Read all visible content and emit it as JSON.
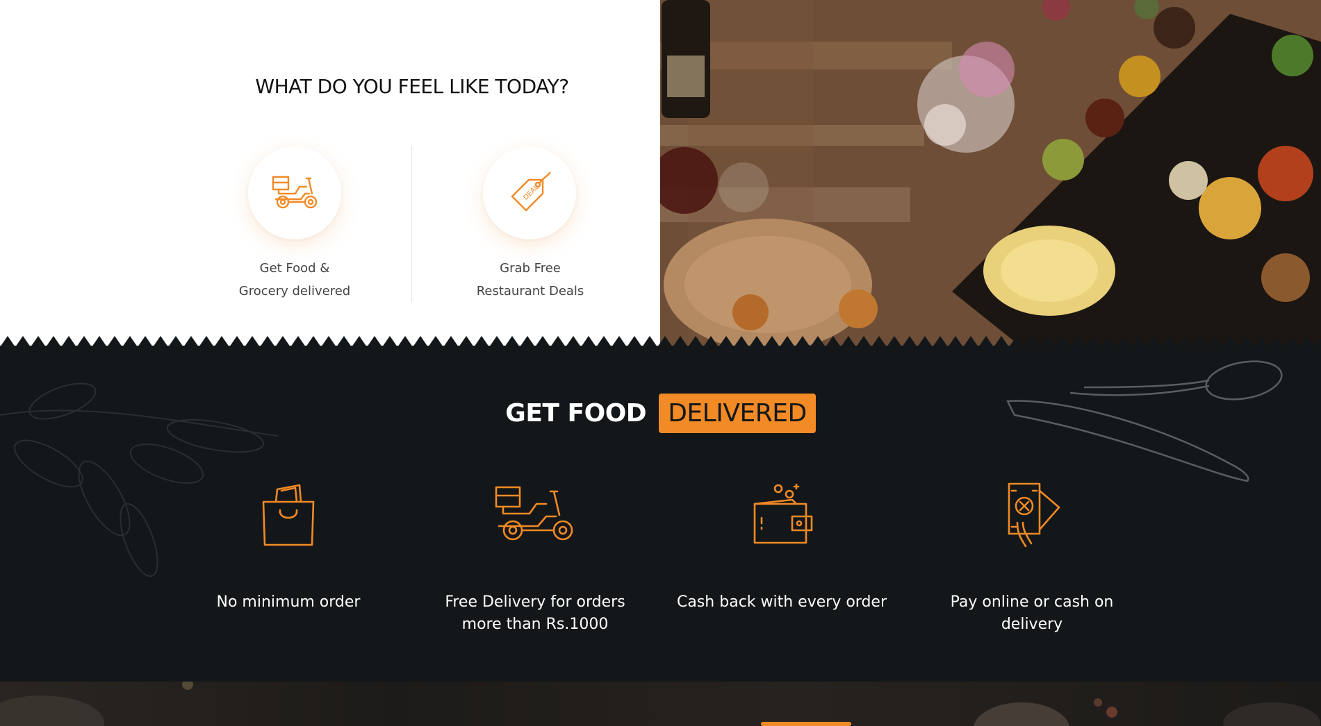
{
  "intro": {
    "title": "WHAT DO YOU FEEL LIKE TODAY?",
    "options": [
      {
        "icon": "delivery-scooter-icon",
        "line1": "Get Food &",
        "line2": "Grocery delivered"
      },
      {
        "icon": "deal-tag-icon",
        "line1": "Grab Free",
        "line2": "Restaurant Deals"
      }
    ]
  },
  "delivery": {
    "heading_white": "GET FOOD",
    "heading_badge": "DELIVERED",
    "features": [
      {
        "icon": "shopping-bag-icon",
        "label": "No minimum order"
      },
      {
        "icon": "delivery-scooter-icon",
        "label": "Free Delivery for orders more than Rs.1000"
      },
      {
        "icon": "wallet-icon",
        "label": "Cash back with every order"
      },
      {
        "icon": "cash-payment-icon",
        "label": "Pay online or cash on delivery"
      }
    ]
  },
  "colors": {
    "accent": "#f28a26",
    "dark_bg": "#141719",
    "text_light": "#ffffff"
  }
}
